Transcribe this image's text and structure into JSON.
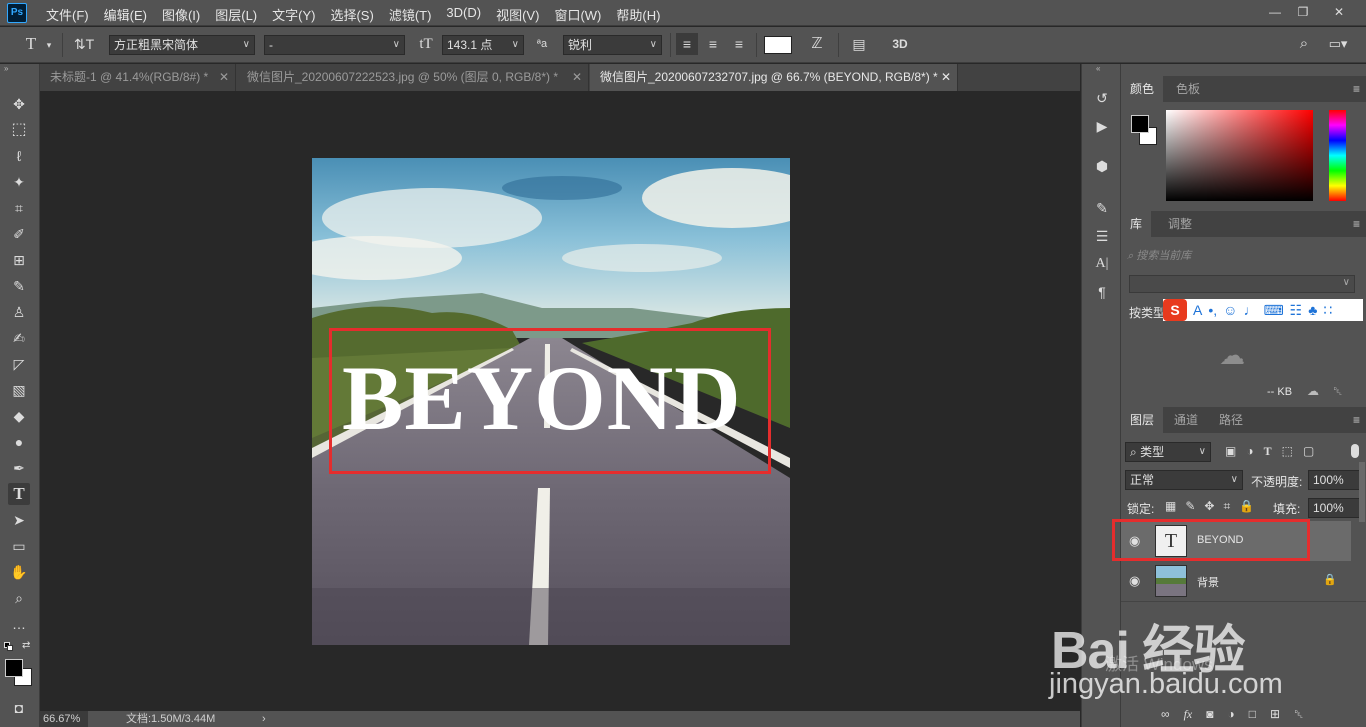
{
  "app": {
    "logo": "Ps"
  },
  "menu": [
    "文件(F)",
    "编辑(E)",
    "图像(I)",
    "图层(L)",
    "文字(Y)",
    "选择(S)",
    "滤镜(T)",
    "3D(D)",
    "视图(V)",
    "窗口(W)",
    "帮助(H)"
  ],
  "options": {
    "font_family": "方正粗黑宋简体",
    "font_style": "-",
    "font_size": "143.1 点",
    "antialias": "锐利",
    "text_color": "#ffffff"
  },
  "tabs": [
    {
      "label": "未标题-1 @ 41.4%(RGB/8#) *"
    },
    {
      "label": "微信图片_20200607222523.jpg @ 50% (图层 0, RGB/8*) *"
    },
    {
      "label": "微信图片_20200607232707.jpg @ 66.7% (BEYOND, RGB/8*) *"
    }
  ],
  "canvas": {
    "overlay_text": "BEYOND",
    "selection_color": "#e52d2d"
  },
  "status": {
    "zoom": "66.67%",
    "doc_size": "文档:1.50M/3.44M"
  },
  "color_panel": {
    "tabs": [
      "颜色",
      "色板"
    ],
    "foreground": "#000000",
    "background": "#ffffff"
  },
  "library_panel": {
    "tabs": [
      "库",
      "调整"
    ],
    "search_placeholder": "搜索当前库",
    "filter_label": "按类型",
    "size_label": "-- KB"
  },
  "layers_panel": {
    "tabs": [
      "图层",
      "通道",
      "路径"
    ],
    "filter_kind": "类型",
    "blend_mode": "正常",
    "opacity_label": "不透明度:",
    "opacity_value": "100%",
    "lock_label": "锁定:",
    "fill_label": "填充:",
    "fill_value": "100%",
    "layers": [
      {
        "name": "BEYOND",
        "type": "text",
        "selected": true
      },
      {
        "name": "背景",
        "type": "image",
        "selected": false,
        "locked": true
      }
    ]
  },
  "watermark": {
    "brand": "Bai 经验",
    "url": "jingyan.baidu.com",
    "activate": "激活 Windows"
  }
}
